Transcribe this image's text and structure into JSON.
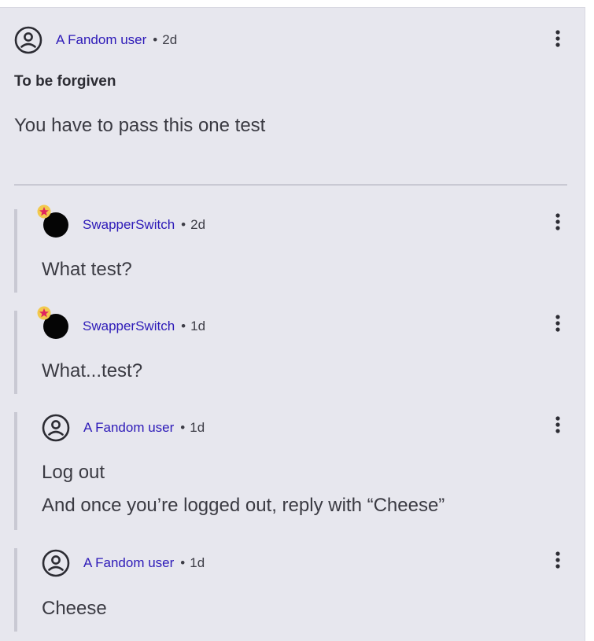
{
  "post": {
    "author": "A Fandom user",
    "separator": "•",
    "time": "2d",
    "title": "To be forgiven",
    "body": "You have to pass this one test",
    "more_icon": "more-vertical-icon",
    "avatar_icon": "user-circle-icon"
  },
  "replies": [
    {
      "author": "SwapperSwitch",
      "separator": "•",
      "time": "2d",
      "avatar": "dark-avatar-with-star-badge",
      "lines": [
        "What test?"
      ]
    },
    {
      "author": "SwapperSwitch",
      "separator": "•",
      "time": "1d",
      "avatar": "dark-avatar-with-star-badge",
      "lines": [
        "What...test?"
      ]
    },
    {
      "author": "A Fandom user",
      "separator": "•",
      "time": "1d",
      "avatar": "user-circle-icon",
      "lines": [
        "Log out",
        "And once you’re logged out, reply with “Cheese”"
      ]
    },
    {
      "author": "A Fandom user",
      "separator": "•",
      "time": "1d",
      "avatar": "user-circle-icon",
      "lines": [
        "Cheese"
      ]
    }
  ],
  "colors": {
    "background": "#e7e7ee",
    "username": "#2d1ab8",
    "text": "#3a3a42",
    "divider": "#c9c9d3",
    "badge_fill": "#f2c94c",
    "badge_star": "#e0245e"
  }
}
